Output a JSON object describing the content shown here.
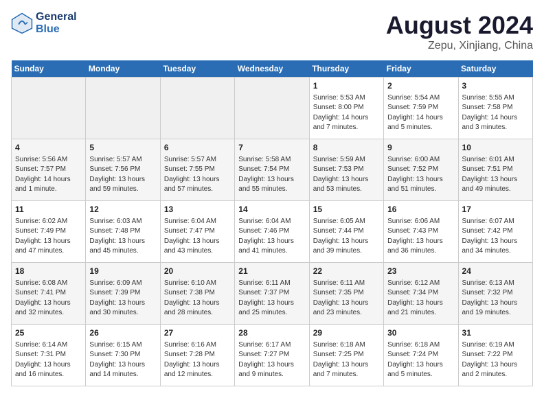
{
  "logo": {
    "line1": "General",
    "line2": "Blue"
  },
  "title": "August 2024",
  "subtitle": "Zepu, Xinjiang, China",
  "days_of_week": [
    "Sunday",
    "Monday",
    "Tuesday",
    "Wednesday",
    "Thursday",
    "Friday",
    "Saturday"
  ],
  "weeks": [
    [
      {
        "day": "",
        "info": ""
      },
      {
        "day": "",
        "info": ""
      },
      {
        "day": "",
        "info": ""
      },
      {
        "day": "",
        "info": ""
      },
      {
        "day": "1",
        "info": "Sunrise: 5:53 AM\nSunset: 8:00 PM\nDaylight: 14 hours\nand 7 minutes."
      },
      {
        "day": "2",
        "info": "Sunrise: 5:54 AM\nSunset: 7:59 PM\nDaylight: 14 hours\nand 5 minutes."
      },
      {
        "day": "3",
        "info": "Sunrise: 5:55 AM\nSunset: 7:58 PM\nDaylight: 14 hours\nand 3 minutes."
      }
    ],
    [
      {
        "day": "4",
        "info": "Sunrise: 5:56 AM\nSunset: 7:57 PM\nDaylight: 14 hours\nand 1 minute."
      },
      {
        "day": "5",
        "info": "Sunrise: 5:57 AM\nSunset: 7:56 PM\nDaylight: 13 hours\nand 59 minutes."
      },
      {
        "day": "6",
        "info": "Sunrise: 5:57 AM\nSunset: 7:55 PM\nDaylight: 13 hours\nand 57 minutes."
      },
      {
        "day": "7",
        "info": "Sunrise: 5:58 AM\nSunset: 7:54 PM\nDaylight: 13 hours\nand 55 minutes."
      },
      {
        "day": "8",
        "info": "Sunrise: 5:59 AM\nSunset: 7:53 PM\nDaylight: 13 hours\nand 53 minutes."
      },
      {
        "day": "9",
        "info": "Sunrise: 6:00 AM\nSunset: 7:52 PM\nDaylight: 13 hours\nand 51 minutes."
      },
      {
        "day": "10",
        "info": "Sunrise: 6:01 AM\nSunset: 7:51 PM\nDaylight: 13 hours\nand 49 minutes."
      }
    ],
    [
      {
        "day": "11",
        "info": "Sunrise: 6:02 AM\nSunset: 7:49 PM\nDaylight: 13 hours\nand 47 minutes."
      },
      {
        "day": "12",
        "info": "Sunrise: 6:03 AM\nSunset: 7:48 PM\nDaylight: 13 hours\nand 45 minutes."
      },
      {
        "day": "13",
        "info": "Sunrise: 6:04 AM\nSunset: 7:47 PM\nDaylight: 13 hours\nand 43 minutes."
      },
      {
        "day": "14",
        "info": "Sunrise: 6:04 AM\nSunset: 7:46 PM\nDaylight: 13 hours\nand 41 minutes."
      },
      {
        "day": "15",
        "info": "Sunrise: 6:05 AM\nSunset: 7:44 PM\nDaylight: 13 hours\nand 39 minutes."
      },
      {
        "day": "16",
        "info": "Sunrise: 6:06 AM\nSunset: 7:43 PM\nDaylight: 13 hours\nand 36 minutes."
      },
      {
        "day": "17",
        "info": "Sunrise: 6:07 AM\nSunset: 7:42 PM\nDaylight: 13 hours\nand 34 minutes."
      }
    ],
    [
      {
        "day": "18",
        "info": "Sunrise: 6:08 AM\nSunset: 7:41 PM\nDaylight: 13 hours\nand 32 minutes."
      },
      {
        "day": "19",
        "info": "Sunrise: 6:09 AM\nSunset: 7:39 PM\nDaylight: 13 hours\nand 30 minutes."
      },
      {
        "day": "20",
        "info": "Sunrise: 6:10 AM\nSunset: 7:38 PM\nDaylight: 13 hours\nand 28 minutes."
      },
      {
        "day": "21",
        "info": "Sunrise: 6:11 AM\nSunset: 7:37 PM\nDaylight: 13 hours\nand 25 minutes."
      },
      {
        "day": "22",
        "info": "Sunrise: 6:11 AM\nSunset: 7:35 PM\nDaylight: 13 hours\nand 23 minutes."
      },
      {
        "day": "23",
        "info": "Sunrise: 6:12 AM\nSunset: 7:34 PM\nDaylight: 13 hours\nand 21 minutes."
      },
      {
        "day": "24",
        "info": "Sunrise: 6:13 AM\nSunset: 7:32 PM\nDaylight: 13 hours\nand 19 minutes."
      }
    ],
    [
      {
        "day": "25",
        "info": "Sunrise: 6:14 AM\nSunset: 7:31 PM\nDaylight: 13 hours\nand 16 minutes."
      },
      {
        "day": "26",
        "info": "Sunrise: 6:15 AM\nSunset: 7:30 PM\nDaylight: 13 hours\nand 14 minutes."
      },
      {
        "day": "27",
        "info": "Sunrise: 6:16 AM\nSunset: 7:28 PM\nDaylight: 13 hours\nand 12 minutes."
      },
      {
        "day": "28",
        "info": "Sunrise: 6:17 AM\nSunset: 7:27 PM\nDaylight: 13 hours\nand 9 minutes."
      },
      {
        "day": "29",
        "info": "Sunrise: 6:18 AM\nSunset: 7:25 PM\nDaylight: 13 hours\nand 7 minutes."
      },
      {
        "day": "30",
        "info": "Sunrise: 6:18 AM\nSunset: 7:24 PM\nDaylight: 13 hours\nand 5 minutes."
      },
      {
        "day": "31",
        "info": "Sunrise: 6:19 AM\nSunset: 7:22 PM\nDaylight: 13 hours\nand 2 minutes."
      }
    ]
  ]
}
